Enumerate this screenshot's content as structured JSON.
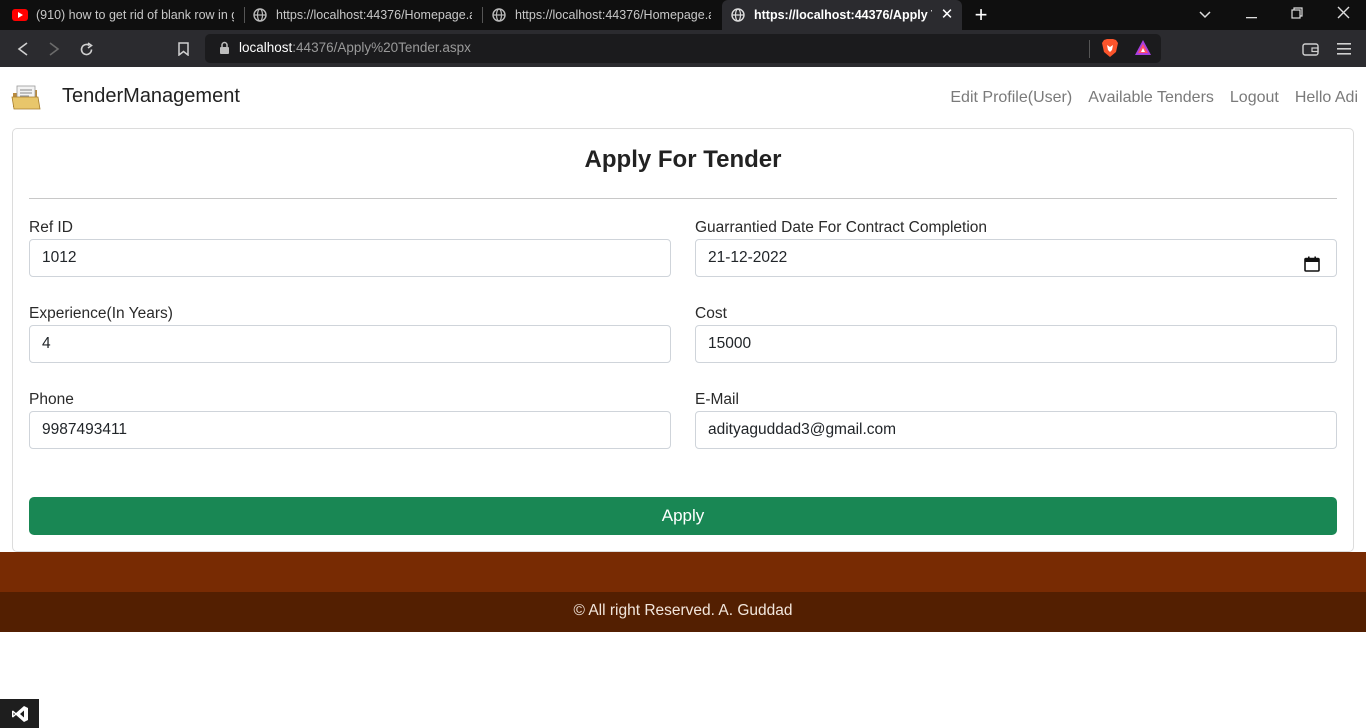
{
  "browser": {
    "tabs": [
      {
        "title": "(910) how to get rid of blank row in gr",
        "icon": "youtube-icon"
      },
      {
        "title": "https://localhost:44376/Homepage.asp",
        "icon": "globe-icon"
      },
      {
        "title": "https://localhost:44376/Homepage.asp",
        "icon": "globe-icon"
      },
      {
        "title": "https://localhost:44376/Apply Ten",
        "icon": "globe-icon"
      }
    ],
    "url_host": "localhost",
    "url_rest": ":44376/Apply%20Tender.aspx"
  },
  "navbar": {
    "brand": "TenderManagement",
    "links": [
      "Edit Profile(User)",
      "Available Tenders",
      "Logout",
      "Hello Adi"
    ]
  },
  "form": {
    "title": "Apply For Tender",
    "ref_id": {
      "label": "Ref ID",
      "value": "1012"
    },
    "completion_date": {
      "label": "Guarrantied Date For Contract Completion",
      "value": "21-12-2022"
    },
    "experience": {
      "label": "Experience(In Years)",
      "value": "4"
    },
    "cost": {
      "label": "Cost",
      "value": "15000"
    },
    "phone": {
      "label": "Phone",
      "value": "9987493411"
    },
    "email": {
      "label": "E-Mail",
      "value": "adityaguddad3@gmail.com"
    },
    "submit_label": "Apply"
  },
  "footer": {
    "text": "© All right Reserved. A. Guddad"
  },
  "colors": {
    "accent_green": "#198754",
    "footer_top": "#782b03",
    "footer_bottom": "#531f01"
  }
}
